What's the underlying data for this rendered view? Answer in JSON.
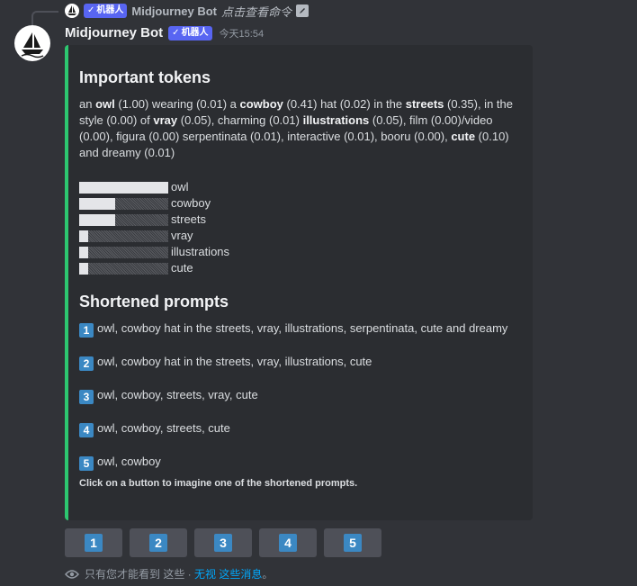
{
  "reply": {
    "bot_badge": "机器人",
    "name": "Midjourney Bot",
    "command_text": "点击查看命令"
  },
  "message": {
    "author": "Midjourney Bot",
    "bot_badge": "机器人",
    "timestamp": "今天15:54"
  },
  "embed": {
    "accent_color": "#2dc770",
    "title": "Important tokens",
    "tokens_segments": [
      {
        "text": "an ",
        "bold": false
      },
      {
        "text": "owl",
        "bold": true
      },
      {
        "text": " (1.00) wearing (0.01) a ",
        "bold": false
      },
      {
        "text": "cowboy",
        "bold": true
      },
      {
        "text": " (0.41) hat (0.02) in the ",
        "bold": false
      },
      {
        "text": "streets",
        "bold": true
      },
      {
        "text": " (0.35), in the style (0.00) of ",
        "bold": false
      },
      {
        "text": "vray",
        "bold": true
      },
      {
        "text": " (0.05), charming (0.01) ",
        "bold": false
      },
      {
        "text": "illustrations",
        "bold": true
      },
      {
        "text": " (0.05), film (0.00)/video (0.00), figura (0.00) serpentinata (0.01), interactive (0.01), booru (0.00), ",
        "bold": false
      },
      {
        "text": "cute",
        "bold": true
      },
      {
        "text": " (0.10) and dreamy (0.01)",
        "bold": false
      }
    ],
    "token_bars": [
      {
        "label": "owl",
        "level": 1.0
      },
      {
        "label": "cowboy",
        "level": 0.4
      },
      {
        "label": "streets",
        "level": 0.4
      },
      {
        "label": "vray",
        "level": 0.1
      },
      {
        "label": "illustrations",
        "level": 0.1
      },
      {
        "label": "cute",
        "level": 0.1
      }
    ],
    "shortened_title": "Shortened prompts",
    "prompts": [
      {
        "num": "1",
        "text": "owl, cowboy hat in the streets, vray, illustrations, serpentinata, cute and dreamy"
      },
      {
        "num": "2",
        "text": "owl, cowboy hat in the streets, vray, illustrations, cute"
      },
      {
        "num": "3",
        "text": "owl, cowboy, streets, vray, cute"
      },
      {
        "num": "4",
        "text": "owl, cowboy, streets, cute"
      },
      {
        "num": "5",
        "text": "owl, cowboy"
      }
    ],
    "footer": "Click on a button to imagine one of the shortened prompts."
  },
  "buttons": [
    "1",
    "2",
    "3",
    "4",
    "5"
  ],
  "ephemeral": {
    "prefix": "只有您才能看到 这些 · ",
    "link": "无视 这些消息",
    "suffix": "。"
  }
}
